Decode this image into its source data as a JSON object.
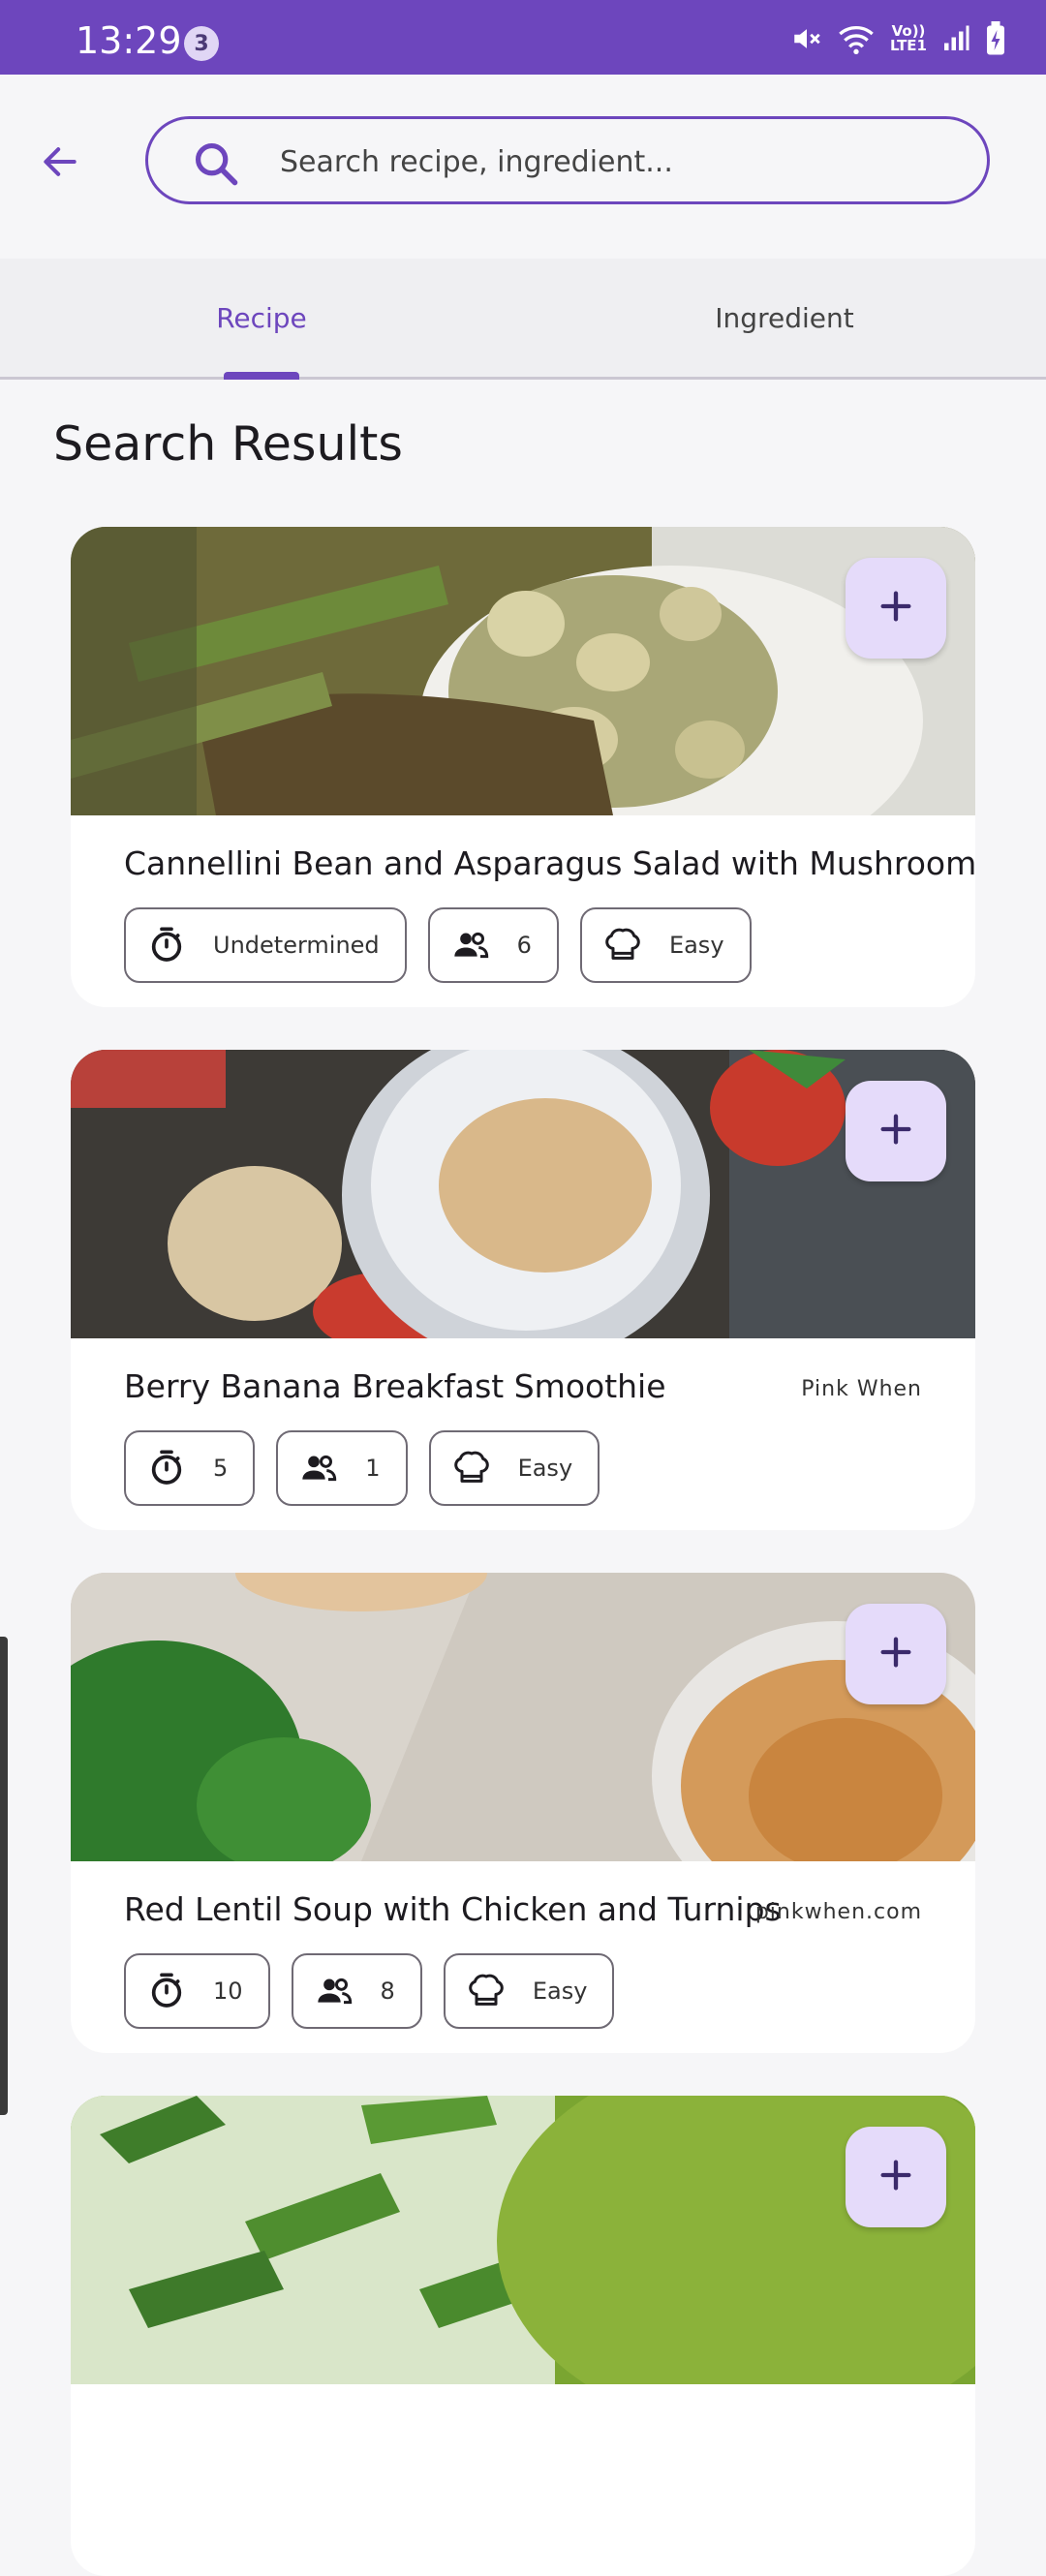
{
  "status_bar": {
    "time": "13:29",
    "notification_count": "3",
    "network_label": "Vo)) LTE1"
  },
  "search": {
    "placeholder": "Search recipe, ingredient..."
  },
  "tabs": [
    {
      "label": "Recipe",
      "active": true
    },
    {
      "label": "Ingredient",
      "active": false
    }
  ],
  "section_title": "Search Results",
  "recipes": [
    {
      "title": "Cannellini Bean and Asparagus Salad with Mushrooms",
      "source": "",
      "time": "Undetermined",
      "servings": "6",
      "difficulty": "Easy"
    },
    {
      "title": "Berry Banana Breakfast Smoothie",
      "source": "Pink When",
      "time": "5",
      "servings": "1",
      "difficulty": "Easy"
    },
    {
      "title": "Red Lentil Soup with Chicken and Turnips",
      "source": "pinkwhen.com",
      "time": "10",
      "servings": "8",
      "difficulty": "Easy"
    },
    {
      "title": "",
      "source": "",
      "time": "",
      "servings": "",
      "difficulty": ""
    }
  ],
  "colors": {
    "accent": "#6d46bd",
    "status_bar": "#6d46bd",
    "add_button_bg": "#e5dbfa"
  }
}
